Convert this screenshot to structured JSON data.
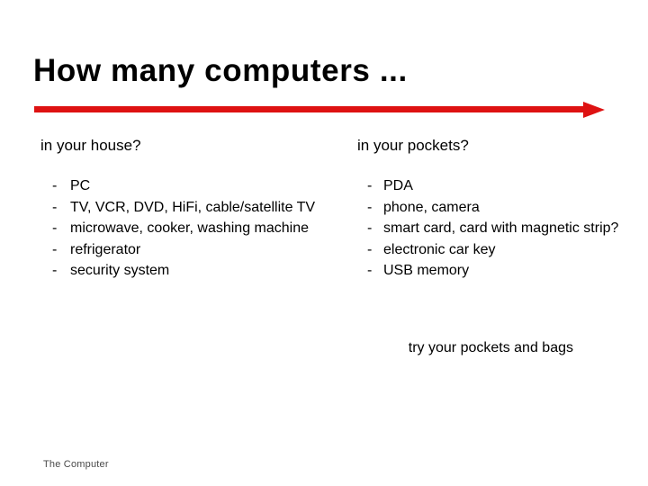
{
  "slide": {
    "title": "How many computers ...",
    "accent_color": "#de1212",
    "text_color": "#000000",
    "background_color": "#ffffff",
    "divider": {
      "name": "red-arrow-rule",
      "color": "#de1212",
      "direction": "right"
    },
    "columns": [
      {
        "heading": "in your house?",
        "items": [
          "PC",
          "TV, VCR, DVD, HiFi, cable/satellite TV",
          "microwave, cooker, washing machine",
          "refrigerator",
          "security system"
        ],
        "bullet_marker": "-"
      },
      {
        "heading": "in your pockets?",
        "items": [
          "PDA",
          "phone, camera",
          "smart card, card with magnetic strip?",
          "electronic car key",
          "USB memory"
        ],
        "bullet_marker": "-"
      }
    ],
    "aside_note": "try your pockets and bags",
    "footer": {
      "label": "The Computer",
      "color": "#4a4a4a"
    }
  }
}
